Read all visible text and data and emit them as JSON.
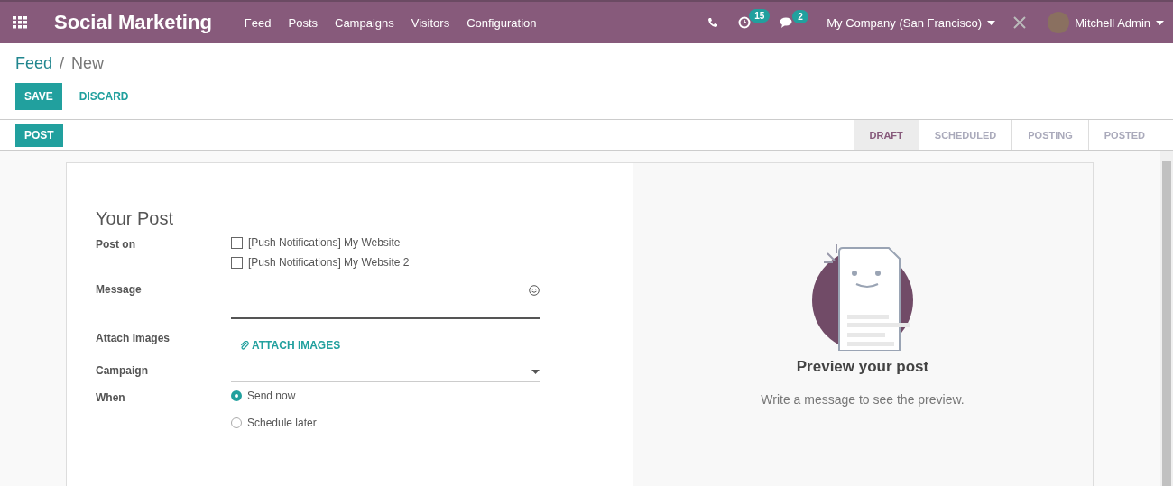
{
  "navbar": {
    "app_title": "Social Marketing",
    "menu": [
      "Feed",
      "Posts",
      "Campaigns",
      "Visitors",
      "Configuration"
    ],
    "activity_count": "15",
    "message_count": "2",
    "company": "My Company (San Francisco)",
    "user": "Mitchell Admin"
  },
  "breadcrumb": {
    "parent": "Feed",
    "separator": "/",
    "current": "New"
  },
  "actions": {
    "save": "SAVE",
    "discard": "DISCARD"
  },
  "post_button": "POST",
  "stages": [
    {
      "label": "DRAFT",
      "selected": true
    },
    {
      "label": "SCHEDULED",
      "selected": false
    },
    {
      "label": "POSTING",
      "selected": false
    },
    {
      "label": "POSTED",
      "selected": false
    }
  ],
  "form": {
    "title": "Your Post",
    "fields": [
      {
        "kind": "checkboxes",
        "label": "Post on",
        "options": [
          {
            "label": "[Push Notifications] My Website",
            "checked": false
          },
          {
            "label": "[Push Notifications] My Website 2",
            "checked": false
          }
        ]
      },
      {
        "kind": "textarea",
        "label": "Message"
      },
      {
        "kind": "button",
        "label": "Attach Images",
        "button": "ATTACH IMAGES"
      },
      {
        "kind": "select",
        "label": "Campaign"
      },
      {
        "kind": "radio",
        "label": "When",
        "options": [
          {
            "label": "Send now",
            "selected": true
          },
          {
            "label": "Schedule later",
            "selected": false
          }
        ]
      }
    ]
  },
  "preview": {
    "title": "Preview your post",
    "text": "Write a message to see the preview."
  }
}
